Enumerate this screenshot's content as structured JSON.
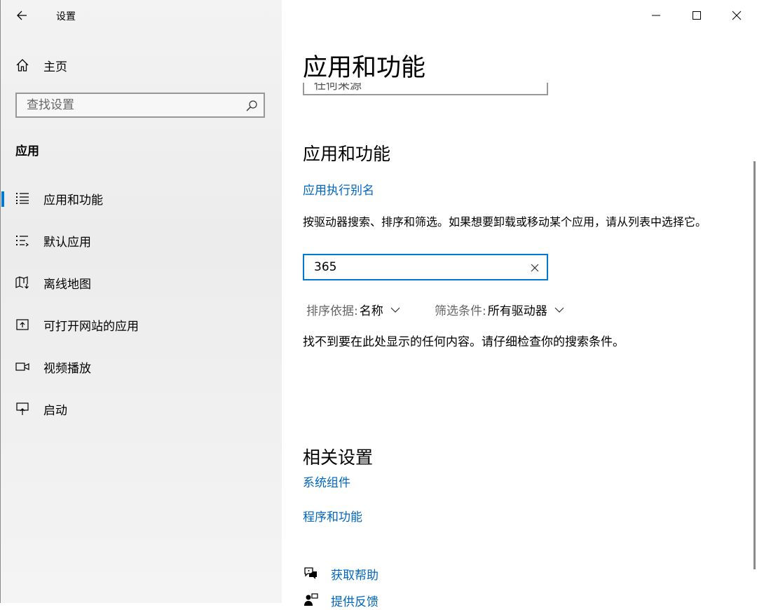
{
  "window": {
    "title": "设置"
  },
  "sidebar": {
    "home_label": "主页",
    "search_placeholder": "查找设置",
    "section_title": "应用",
    "items": [
      {
        "label": "应用和功能",
        "icon": "apps-list-icon",
        "selected": true
      },
      {
        "label": "默认应用",
        "icon": "default-apps-icon",
        "selected": false
      },
      {
        "label": "离线地图",
        "icon": "offline-map-icon",
        "selected": false
      },
      {
        "label": "可打开网站的应用",
        "icon": "open-website-icon",
        "selected": false
      },
      {
        "label": "视频播放",
        "icon": "video-camera-icon",
        "selected": false
      },
      {
        "label": "启动",
        "icon": "startup-icon",
        "selected": false
      }
    ]
  },
  "main": {
    "page_title": "应用和功能",
    "cut_off_text": "任何来源",
    "section_heading": "应用和功能",
    "alias_link": "应用执行别名",
    "description": "按驱动器搜索、排序和筛选。如果想要卸载或移动某个应用，请从列表中选择它。",
    "filter_value": "365",
    "sort_label": "排序依据:",
    "sort_value": "名称",
    "filter_label": "筛选条件:",
    "filter_drive": "所有驱动器",
    "empty_message": "找不到要在此处显示的任何内容。请仔细检查你的搜索条件。",
    "related_heading": "相关设置",
    "related_links": [
      "系统组件",
      "程序和功能"
    ],
    "help_links": [
      {
        "label": "获取帮助",
        "icon": "help-chat-icon"
      },
      {
        "label": "提供反馈",
        "icon": "feedback-icon"
      }
    ]
  },
  "colors": {
    "accent": "#0078d4",
    "link": "#0067c0",
    "sidebar_bg": "#f0f0f0"
  }
}
